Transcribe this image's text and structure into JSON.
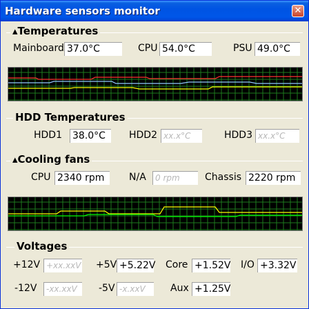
{
  "window": {
    "title": "Hardware sensors monitor"
  },
  "temperatures": {
    "label": "Temperatures",
    "mainboard_label": "Mainboard",
    "mainboard_value": "37.0°C",
    "cpu_label": "CPU",
    "cpu_value": "54.0°C",
    "psu_label": "PSU",
    "psu_value": "49.0°C"
  },
  "hdd": {
    "label": "HDD Temperatures",
    "hdd1_label": "HDD1",
    "hdd1_value": "38.0°C",
    "hdd2_label": "HDD2",
    "hdd2_value": "xx.x°C",
    "hdd3_label": "HDD3",
    "hdd3_value": "xx.x°C"
  },
  "fans": {
    "label": "Cooling fans",
    "cpu_label": "CPU",
    "cpu_value": "2340 rpm",
    "na_label": "N/A",
    "na_value": "0 rpm",
    "chassis_label": "Chassis",
    "chassis_value": "2220 rpm"
  },
  "voltages": {
    "label": "Voltages",
    "p12_label": "+12V",
    "p12_value": "+xx.xxV",
    "p5_label": "+5V",
    "p5_value": "+5.22V",
    "core_label": "Core",
    "core_value": "+1.52V",
    "io_label": "I/O",
    "io_value": "+3.32V",
    "m12_label": "-12V",
    "m12_value": "-xx.xxV",
    "m5_label": "-5V",
    "m5_value": "-x.xxV",
    "aux_label": "Aux",
    "aux_value": "+1.25V"
  },
  "colors": {
    "graph_grid": "#1e7a1e",
    "line_mainboard": "#ffff00",
    "line_cpu": "#ff3030",
    "line_psu": "#90c8ff",
    "line_fan_cpu": "#ffff00",
    "line_fan_chassis": "#00ff00"
  }
}
